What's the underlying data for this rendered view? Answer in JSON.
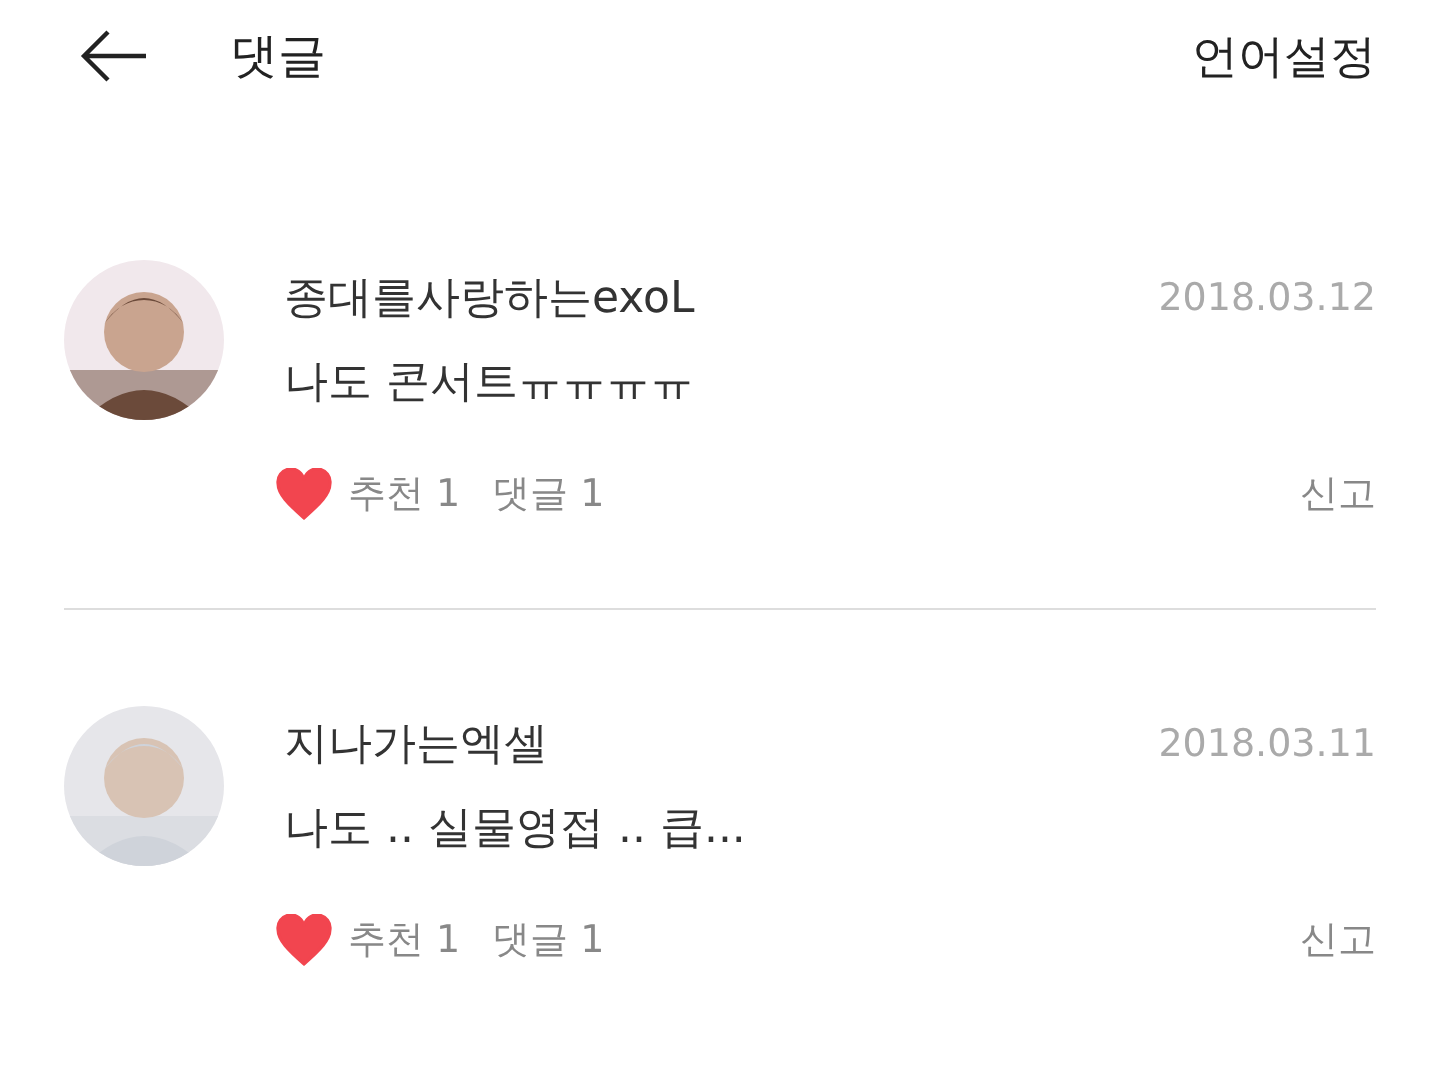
{
  "header": {
    "title": "댓글",
    "action": "언어설정"
  },
  "comments": [
    {
      "author": "종대를사랑하는exoL",
      "date": "2018.03.12",
      "text": "나도 콘서트ㅠㅠㅠㅠ",
      "liked": true,
      "likes": "추천 1",
      "replies": "댓글 1",
      "report": "신고"
    },
    {
      "author": "지나가는엑셀",
      "date": "2018.03.11",
      "text": "나도 .. 실물영접 .. 큽...",
      "liked": true,
      "likes": "추천 1",
      "replies": "댓글 1",
      "report": "신고"
    }
  ]
}
